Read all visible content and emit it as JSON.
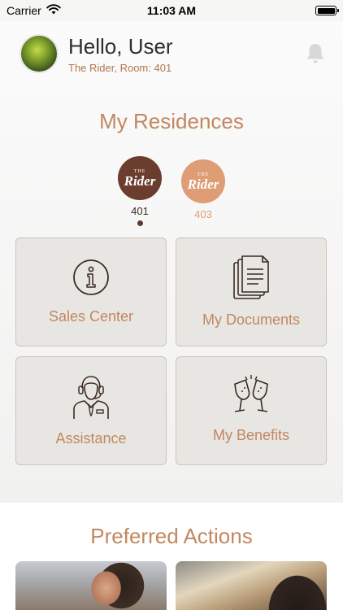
{
  "status_bar": {
    "carrier": "Carrier",
    "time": "11:03 AM"
  },
  "header": {
    "greeting": "Hello, User",
    "subtitle": "The Rider, Room: 401"
  },
  "residences": {
    "title": "My Residences",
    "items": [
      {
        "logo_small": "THE",
        "logo_big": "Rider",
        "number": "401",
        "selected": true,
        "color": "#6b3d2e"
      },
      {
        "logo_small": "THE",
        "logo_big": "Rider",
        "number": "403",
        "selected": false,
        "color": "#df9d76"
      }
    ]
  },
  "cards": [
    {
      "label": "Sales Center",
      "icon": "info-icon"
    },
    {
      "label": "My Documents",
      "icon": "documents-icon"
    },
    {
      "label": "Assistance",
      "icon": "support-agent-icon"
    },
    {
      "label": "My Benefits",
      "icon": "champagne-glasses-icon"
    }
  ],
  "preferred": {
    "title": "Preferred Actions"
  },
  "colors": {
    "accent": "#c28760",
    "card_bg": "#e8e6e2",
    "card_border": "#cfc5b6",
    "primary_brown": "#6b3d2e"
  }
}
